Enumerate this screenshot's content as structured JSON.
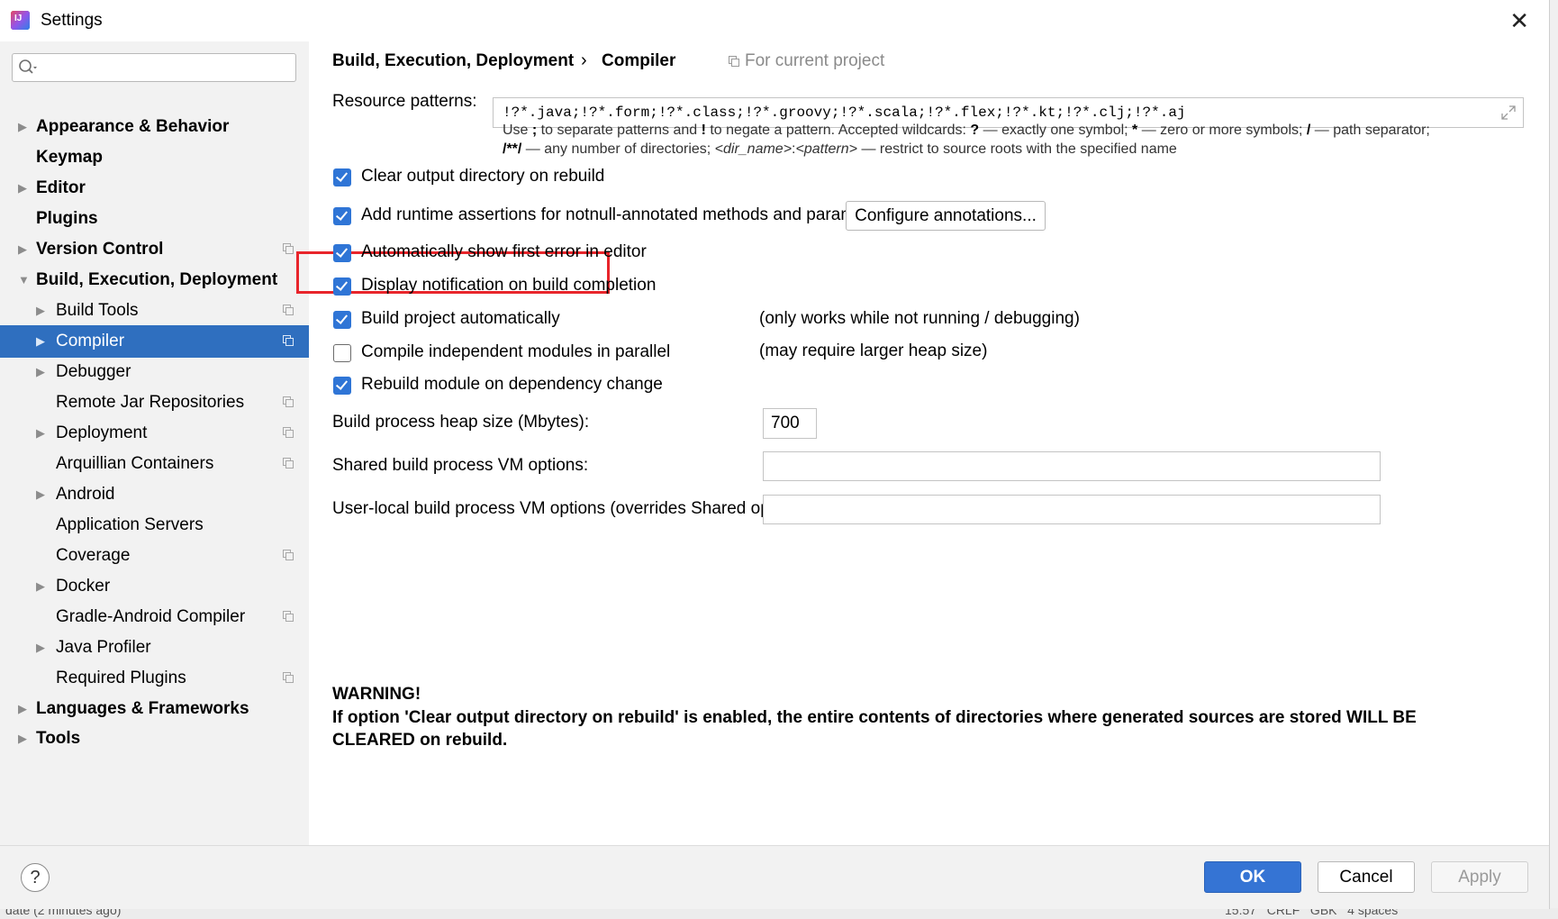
{
  "window": {
    "title": "Settings"
  },
  "sidebar": {
    "search_placeholder": "",
    "items": [
      {
        "label": "Appearance & Behavior",
        "level": 0,
        "arrow": "right",
        "bold": true,
        "proj": false
      },
      {
        "label": "Keymap",
        "level": 0,
        "arrow": "none",
        "bold": true,
        "proj": false
      },
      {
        "label": "Editor",
        "level": 0,
        "arrow": "right",
        "bold": true,
        "proj": false
      },
      {
        "label": "Plugins",
        "level": 0,
        "arrow": "none",
        "bold": true,
        "proj": false
      },
      {
        "label": "Version Control",
        "level": 0,
        "arrow": "right",
        "bold": true,
        "proj": true
      },
      {
        "label": "Build, Execution, Deployment",
        "level": 0,
        "arrow": "down",
        "bold": true,
        "proj": false
      },
      {
        "label": "Build Tools",
        "level": 1,
        "arrow": "right",
        "bold": false,
        "proj": true
      },
      {
        "label": "Compiler",
        "level": 1,
        "arrow": "right",
        "bold": false,
        "proj": true,
        "selected": true
      },
      {
        "label": "Debugger",
        "level": 1,
        "arrow": "right",
        "bold": false,
        "proj": false
      },
      {
        "label": "Remote Jar Repositories",
        "level": 1,
        "arrow": "none",
        "bold": false,
        "proj": true
      },
      {
        "label": "Deployment",
        "level": 1,
        "arrow": "right",
        "bold": false,
        "proj": true
      },
      {
        "label": "Arquillian Containers",
        "level": 1,
        "arrow": "none",
        "bold": false,
        "proj": true
      },
      {
        "label": "Android",
        "level": 1,
        "arrow": "right",
        "bold": false,
        "proj": false
      },
      {
        "label": "Application Servers",
        "level": 1,
        "arrow": "none",
        "bold": false,
        "proj": false
      },
      {
        "label": "Coverage",
        "level": 1,
        "arrow": "none",
        "bold": false,
        "proj": true
      },
      {
        "label": "Docker",
        "level": 1,
        "arrow": "right",
        "bold": false,
        "proj": false
      },
      {
        "label": "Gradle-Android Compiler",
        "level": 1,
        "arrow": "none",
        "bold": false,
        "proj": true
      },
      {
        "label": "Java Profiler",
        "level": 1,
        "arrow": "right",
        "bold": false,
        "proj": false
      },
      {
        "label": "Required Plugins",
        "level": 1,
        "arrow": "none",
        "bold": false,
        "proj": true
      },
      {
        "label": "Languages & Frameworks",
        "level": 0,
        "arrow": "right",
        "bold": true,
        "proj": false
      },
      {
        "label": "Tools",
        "level": 0,
        "arrow": "right",
        "bold": true,
        "proj": false
      }
    ]
  },
  "breadcrumb": {
    "parent": "Build, Execution, Deployment",
    "separator": "›",
    "current": "Compiler",
    "scope": "For current project"
  },
  "resource_patterns": {
    "label": "Resource patterns:",
    "value": "!?*.java;!?*.form;!?*.class;!?*.groovy;!?*.scala;!?*.flex;!?*.kt;!?*.clj;!?*.aj",
    "hint_line1": {
      "a": "Use ",
      "b": ";",
      "c": " to separate patterns and ",
      "d": "!",
      "e": " to negate a pattern. Accepted wildcards: ",
      "f": "?",
      "g": " — exactly one symbol; ",
      "h": "*",
      "i": " — zero or more symbols; ",
      "j": "/",
      "k": " — path separator;"
    },
    "hint_line2": {
      "a": "/**/",
      "b": " — any number of directories; ",
      "c": "<dir_name>",
      "d": ":",
      "e": "<pattern>",
      "f": " — restrict to source roots with the specified name"
    }
  },
  "options": [
    {
      "label": "Clear output directory on rebuild",
      "checked": true
    },
    {
      "label": "Add runtime assertions for notnull-annotated methods and parameters",
      "checked": true
    },
    {
      "label": "Automatically show first error in editor",
      "checked": true
    },
    {
      "label": "Display notification on build completion",
      "checked": true
    },
    {
      "label": "Build project automatically",
      "checked": true
    },
    {
      "label": "Compile independent modules in parallel",
      "checked": false
    },
    {
      "label": "Rebuild module on dependency change",
      "checked": true
    }
  ],
  "notes": {
    "build_auto": "(only works while not running / debugging)",
    "parallel": "(may require larger heap size)"
  },
  "configure_button": "Configure annotations...",
  "heap": {
    "label": "Build process heap size (Mbytes):",
    "value": "700"
  },
  "shared_vm": {
    "label": "Shared build process VM options:",
    "value": ""
  },
  "user_vm": {
    "label": "User-local build process VM options (overrides Shared options):",
    "value": ""
  },
  "warning": {
    "title": "WARNING!",
    "body": "If option 'Clear output directory on rebuild' is enabled, the entire contents of directories where generated sources are stored WILL BE CLEARED on rebuild."
  },
  "footer": {
    "help": "?",
    "ok": "OK",
    "cancel": "Cancel",
    "apply": "Apply"
  },
  "background": {
    "status_left": "date (2 minutes ago)",
    "status_right": "15:57   CRLF   GBK   4 spaces"
  },
  "colors": {
    "selection": "#2f6fbf",
    "checkbox": "#2f75d6",
    "highlight": "#e8252b",
    "primary_button": "#3574d4"
  }
}
